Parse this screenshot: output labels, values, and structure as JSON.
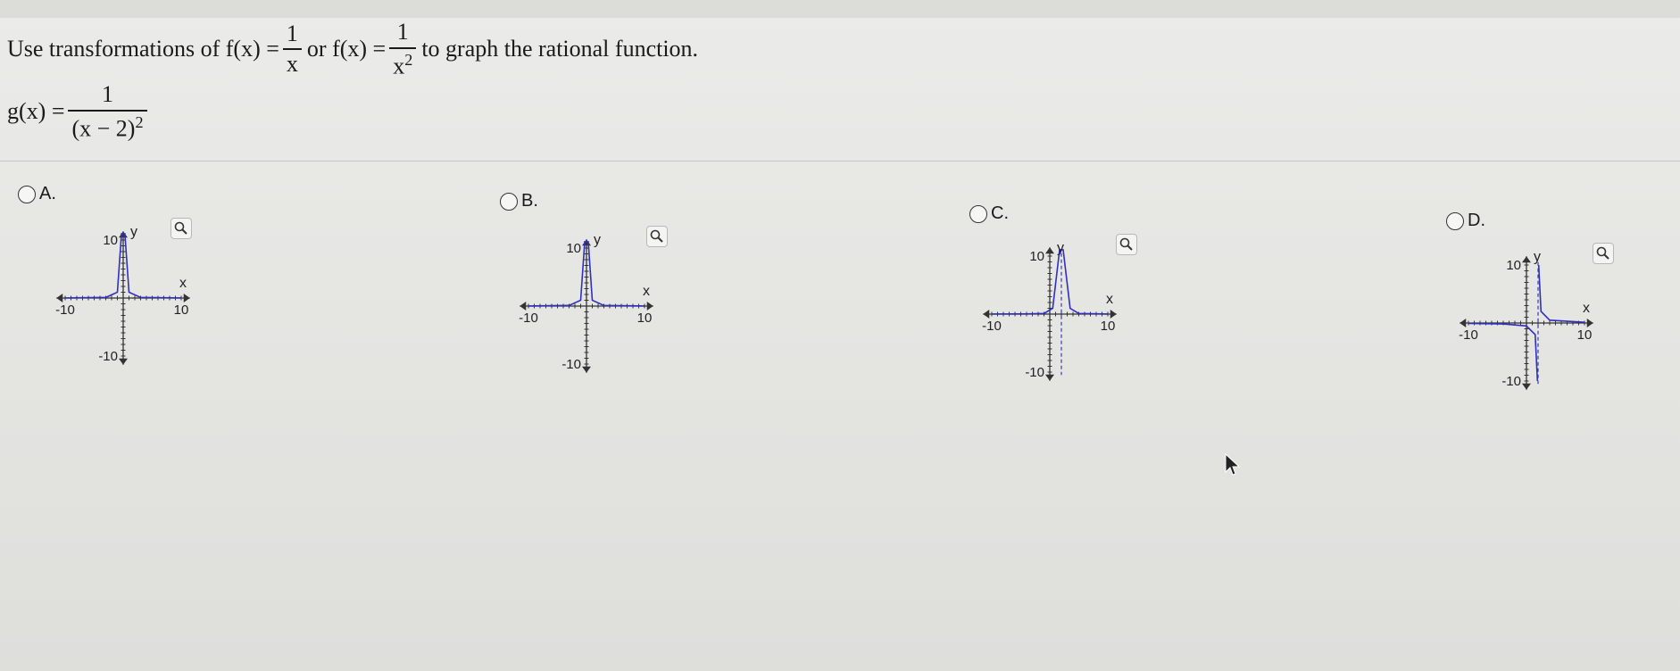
{
  "question": {
    "prefix": "Use transformations of f(x) =",
    "frac1": {
      "num": "1",
      "den": "x"
    },
    "connector": "or f(x) =",
    "frac2": {
      "num": "1",
      "den_base": "x",
      "den_exp": "2"
    },
    "suffix": "to graph the rational function."
  },
  "function": {
    "lhs": "g(x) =",
    "num": "1",
    "den": "(x − 2)",
    "den_exp": "2"
  },
  "options": [
    {
      "letter": "A.",
      "x_label": "x",
      "y_label": "y",
      "x_min": "-10",
      "x_max": "10",
      "y_min": "-10",
      "y_max": "10"
    },
    {
      "letter": "B.",
      "x_label": "x",
      "y_label": "y",
      "x_min": "-10",
      "x_max": "10",
      "y_min": "-10",
      "y_max": "10"
    },
    {
      "letter": "C.",
      "x_label": "x",
      "y_label": "y",
      "x_min": "-10",
      "x_max": "10",
      "y_min": "-10",
      "y_max": "10"
    },
    {
      "letter": "D.",
      "x_label": "x",
      "y_label": "y",
      "x_min": "-10",
      "x_max": "10",
      "y_min": "-10",
      "y_max": "10"
    }
  ],
  "chart_data": [
    {
      "type": "line",
      "series": [
        {
          "values": [
            [
              -10,
              0.01
            ],
            [
              -3,
              0.11
            ],
            [
              -1,
              1
            ],
            [
              -0.3,
              11.1
            ],
            [
              0.3,
              11.1
            ],
            [
              1,
              1
            ],
            [
              3,
              0.11
            ],
            [
              10,
              0.01
            ]
          ]
        }
      ],
      "asymptote_x": 0,
      "xlim": [
        -10,
        10
      ],
      "ylim": [
        -10,
        10
      ]
    },
    {
      "type": "line",
      "series": [
        {
          "values": [
            [
              -10,
              0.01
            ],
            [
              -3,
              0.11
            ],
            [
              -1,
              1
            ],
            [
              -0.3,
              11.1
            ],
            [
              0.3,
              11.1
            ],
            [
              1,
              1
            ],
            [
              3,
              0.11
            ],
            [
              10,
              0.01
            ]
          ]
        }
      ],
      "asymptote_x": 0,
      "xlim": [
        -10,
        10
      ],
      "ylim": [
        -10,
        10
      ]
    },
    {
      "type": "line",
      "series": [
        {
          "values": [
            [
              -10,
              0.01
            ],
            [
              -4,
              0.03
            ],
            [
              -1,
              0.11
            ],
            [
              0.5,
              1
            ],
            [
              1.7,
              11.1
            ],
            [
              2.3,
              11.1
            ],
            [
              3.5,
              1
            ],
            [
              5,
              0.11
            ],
            [
              10,
              0.02
            ]
          ]
        }
      ],
      "asymptote_x": 2,
      "xlim": [
        -10,
        10
      ],
      "ylim": [
        -10,
        10
      ]
    },
    {
      "type": "line",
      "series": [
        {
          "values": [
            [
              -10,
              -0.08
            ],
            [
              -4,
              -0.17
            ],
            [
              0,
              -0.5
            ],
            [
              1.5,
              -2
            ],
            [
              1.9,
              -10
            ]
          ]
        },
        {
          "values": [
            [
              2.1,
              10
            ],
            [
              2.5,
              2
            ],
            [
              4,
              0.5
            ],
            [
              10,
              0.13
            ]
          ]
        }
      ],
      "asymptote_x": 2,
      "xlim": [
        -10,
        10
      ],
      "ylim": [
        -10,
        10
      ]
    }
  ]
}
